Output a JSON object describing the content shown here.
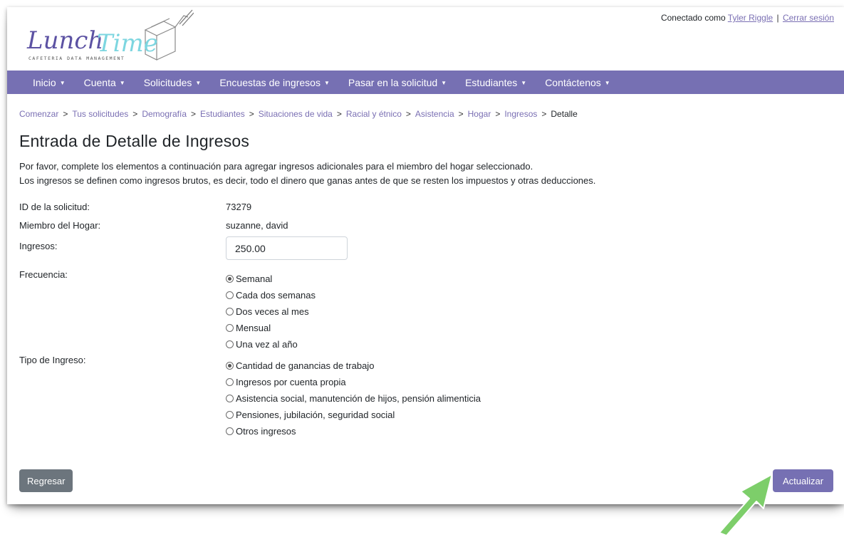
{
  "header": {
    "logo_text": "LunchTime",
    "logo_subtext": "Cafeteria Data Management",
    "connected_as": "Conectado como",
    "user_name": "Tyler Riggle",
    "separator": "|",
    "logout": "Cerrar sesión"
  },
  "nav": {
    "items": [
      {
        "label": "Inicio"
      },
      {
        "label": "Cuenta"
      },
      {
        "label": "Solicitudes"
      },
      {
        "label": "Encuestas de ingresos"
      },
      {
        "label": "Pasar en la solicitud"
      },
      {
        "label": "Estudiantes"
      },
      {
        "label": "Contáctenos"
      }
    ]
  },
  "breadcrumb": {
    "items": [
      "Comenzar",
      "Tus solicitudes",
      "Demografía",
      "Estudiantes",
      "Situaciones de vida",
      "Racial y étnico",
      "Asistencia",
      "Hogar",
      "Ingresos",
      "Detalle"
    ],
    "separator": ">"
  },
  "page": {
    "title": "Entrada de Detalle de Ingresos",
    "intro_line1": "Por favor, complete los elementos a continuación para agregar ingresos adicionales para el miembro del hogar seleccionado.",
    "intro_line2": "Los ingresos se definen como ingresos brutos, es decir, todo el dinero que ganas antes de que se resten los impuestos y otras deducciones."
  },
  "form": {
    "application_id_label": "ID de la solicitud:",
    "application_id_value": "73279",
    "member_label": "Miembro del Hogar:",
    "member_value": "suzanne, david",
    "income_label": "Ingresos:",
    "income_value": "250.00",
    "frequency_label": "Frecuencia:",
    "frequency_options": [
      {
        "label": "Semanal",
        "checked": true
      },
      {
        "label": "Cada dos semanas",
        "checked": false
      },
      {
        "label": "Dos veces al mes",
        "checked": false
      },
      {
        "label": "Mensual",
        "checked": false
      },
      {
        "label": "Una vez al año",
        "checked": false
      }
    ],
    "type_label": "Tipo de Ingreso:",
    "type_options": [
      {
        "label": "Cantidad de ganancias de trabajo",
        "checked": true
      },
      {
        "label": "Ingresos por cuenta propia",
        "checked": false
      },
      {
        "label": "Asistencia social, manutención de hijos, pensión alimenticia",
        "checked": false
      },
      {
        "label": "Pensiones, jubilación, seguridad social",
        "checked": false
      },
      {
        "label": "Otros ingresos",
        "checked": false
      }
    ]
  },
  "buttons": {
    "back": "Regresar",
    "update": "Actualizar"
  },
  "colors": {
    "brand_purple": "#7670b3",
    "link_purple": "#7a6fb3",
    "back_gray": "#6c757d",
    "annotation_green": "#7dce6a"
  }
}
